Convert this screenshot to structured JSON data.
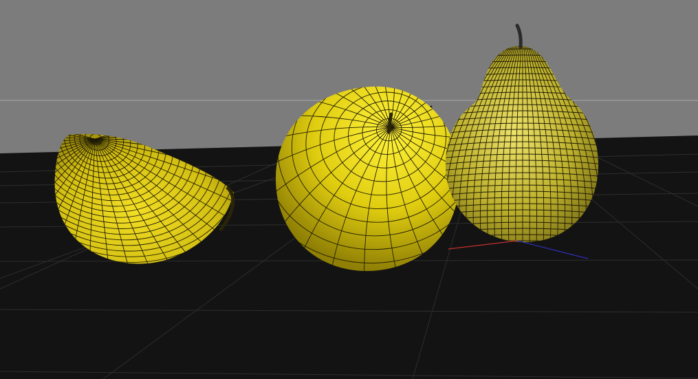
{
  "viewport": {
    "background_color": "#7c7c7c",
    "floor_color": "#131313",
    "grid_color": "#2e2e2e",
    "horizon_line_color": "#a9a9a9",
    "wire_color": "#1f1a05"
  },
  "objects": [
    {
      "name": "pear-slice",
      "fill_color": "#d4c012"
    },
    {
      "name": "apple-pear",
      "fill_color": "#e0cd10"
    },
    {
      "name": "pear",
      "fill_color": "#bdb12d"
    }
  ],
  "gizmo": {
    "x_axis_color": "#c4302f",
    "z_axis_color": "#2d2fb6"
  }
}
